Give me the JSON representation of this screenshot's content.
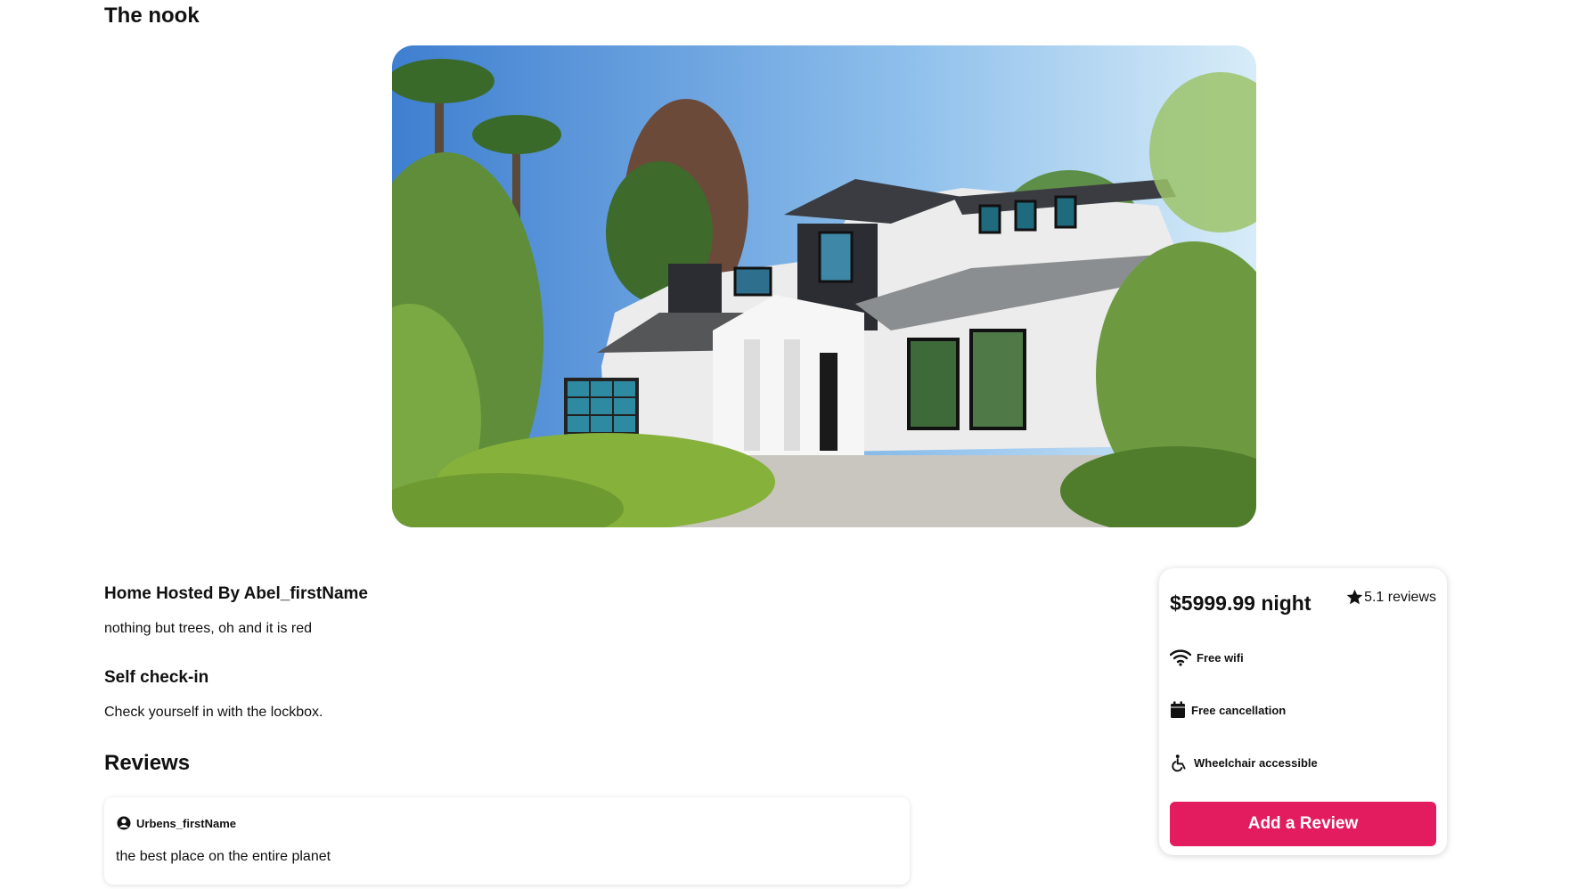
{
  "listing": {
    "title": "The nook",
    "hero_image_alt": "House photo"
  },
  "host": {
    "heading": "Home Hosted By Abel_firstName",
    "description": "nothing but trees, oh and it is red"
  },
  "checkin": {
    "heading": "Self check-in",
    "description": "Check yourself in with the lockbox."
  },
  "reviews": {
    "heading": "Reviews",
    "items": [
      {
        "author": "Urbens_firstName",
        "text": "the best place on the entire planet",
        "icon": "account-circle-icon"
      }
    ]
  },
  "booking": {
    "price": "$5999.99 night",
    "rating_value": "5",
    "rating_reviews": " .1 reviews",
    "rating_icon": "star-icon",
    "amenities": [
      {
        "label": "Free wifi",
        "icon": "wifi-icon"
      },
      {
        "label": "Free cancellation",
        "icon": "calendar-icon"
      },
      {
        "label": "Wheelchair accessible",
        "icon": "wheelchair-icon"
      }
    ],
    "add_review_label": "Add a Review",
    "accent_color": "#e31c5f"
  }
}
